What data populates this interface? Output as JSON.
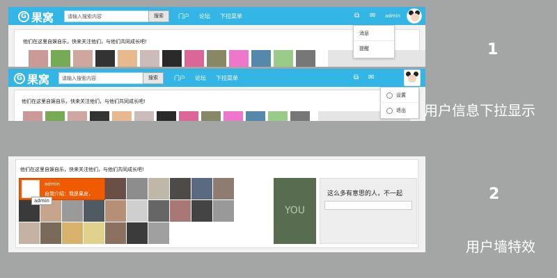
{
  "logo": {
    "text": "果窝",
    "g": "G"
  },
  "search": {
    "placeholder": "请输入搜索内容",
    "button": "搜索"
  },
  "nav": [
    "门户",
    "论坛",
    "下拉菜单"
  ],
  "user": {
    "name": "admin"
  },
  "slogan": "他们在这里自娱自乐，快来关注他们，与他们共同成长吧!",
  "dropdown1": [
    "消息",
    "提醒"
  ],
  "dropdown2": [
    "设置",
    "退出"
  ],
  "steps": {
    "one": "1",
    "two": "2"
  },
  "captions": {
    "dropdown": "用户信息下拉显示",
    "wall": "用户墙特效"
  },
  "wall": {
    "card_name": "admin",
    "card_intro": "自我介绍：我是果皮，",
    "tooltip": "admin",
    "you_text": "YOU",
    "right_question": "这么多有意思的人，不一起"
  },
  "colors": {
    "brand": "#33b5e5",
    "accent": "#f05a00",
    "bg": "#a3a6a5"
  },
  "thumb_colors": [
    "#c99",
    "#7a5",
    "#cfa7a0",
    "#333",
    "#e8b88f",
    "#cbb",
    "#2a2a2a",
    "#d69",
    "#886",
    "#e7c",
    "#58a",
    "#9c8",
    "#777",
    "#a3b8d6",
    "#bbb",
    "#8bc34a"
  ],
  "wall_colors": [
    "#d9c7bb",
    "#b8aa9e",
    "#7d7d7d",
    "#c9a08a",
    "#6a4f47",
    "#8d8d8d",
    "#bfb8a8",
    "#4e4a48",
    "#5a6a80",
    "#2d3540",
    "#8f7c70",
    "#3a3a3a",
    "#c7a58c",
    "#9a9a9a",
    "#505a62",
    "#b58f76",
    "#cfcfcf",
    "#666",
    "#a77",
    "#4a5568",
    "#444",
    "#999",
    "#c4b3a3",
    "#7a6a5a",
    "#d9b36b",
    "#e0d28c",
    "#8c7060",
    "#3b3b3b",
    "#a0a0a0",
    "#6e6258"
  ]
}
